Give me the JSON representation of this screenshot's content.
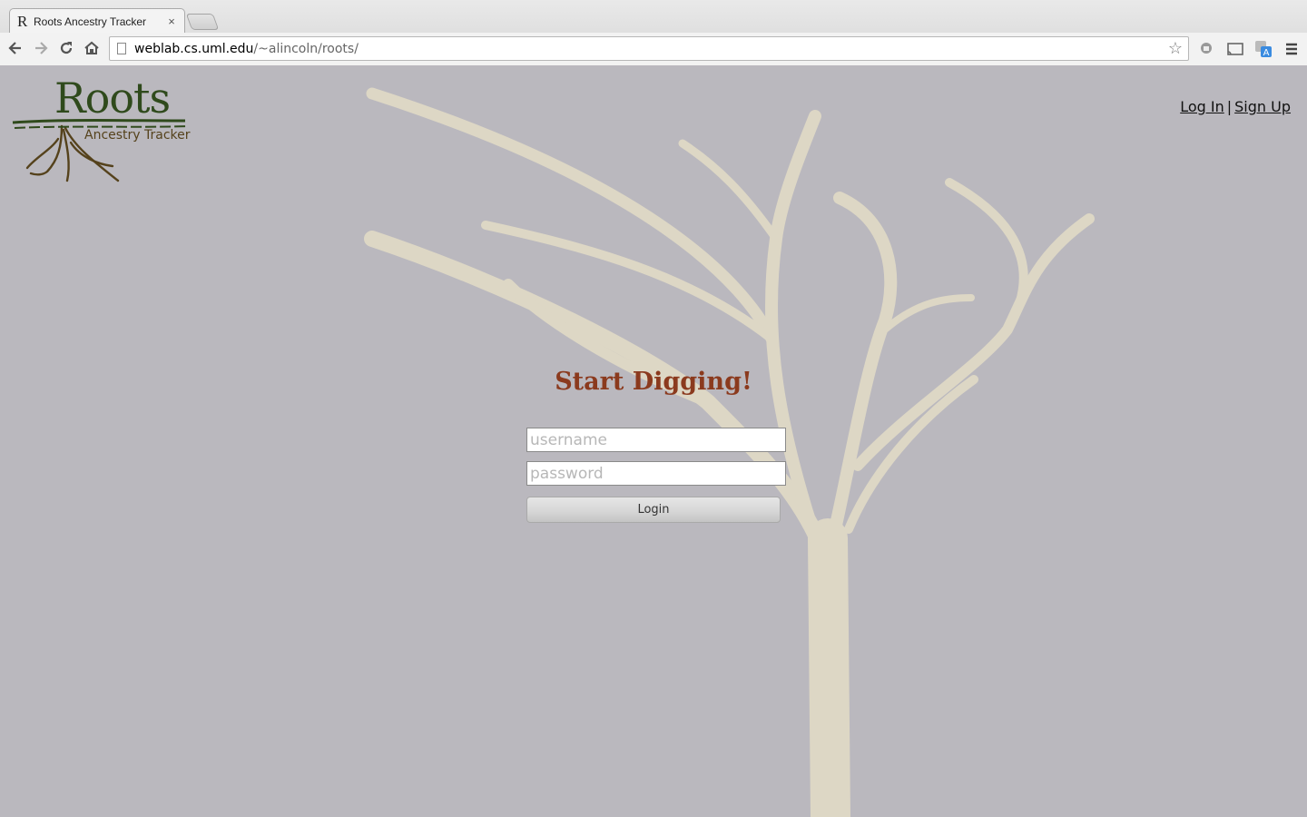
{
  "browser": {
    "tab_title": "Roots Ancestry Tracker",
    "tab_favicon": "R",
    "tab_close": "×",
    "url_host": "weblab.cs.uml.edu",
    "url_path": "/~alincoln/roots/",
    "icons": [
      "back-icon",
      "forward-icon",
      "reload-icon",
      "home-icon",
      "page-icon",
      "star-icon",
      "extension-icon",
      "cast-icon",
      "translate-icon",
      "menu-icon"
    ]
  },
  "logo": {
    "title": "Roots",
    "subtitle": "Ancestry Tracker"
  },
  "auth_links": {
    "login": "Log In",
    "separator": "|",
    "signup": "Sign Up"
  },
  "form": {
    "heading": "Start Digging!",
    "username_placeholder": "username",
    "password_placeholder": "password",
    "submit_label": "Login"
  },
  "colors": {
    "page_background": "#bab8be",
    "tree": "#ddd7c5",
    "heading": "#8b3a1e",
    "logo_green": "#2f4a1c",
    "logo_brown": "#55421c"
  }
}
